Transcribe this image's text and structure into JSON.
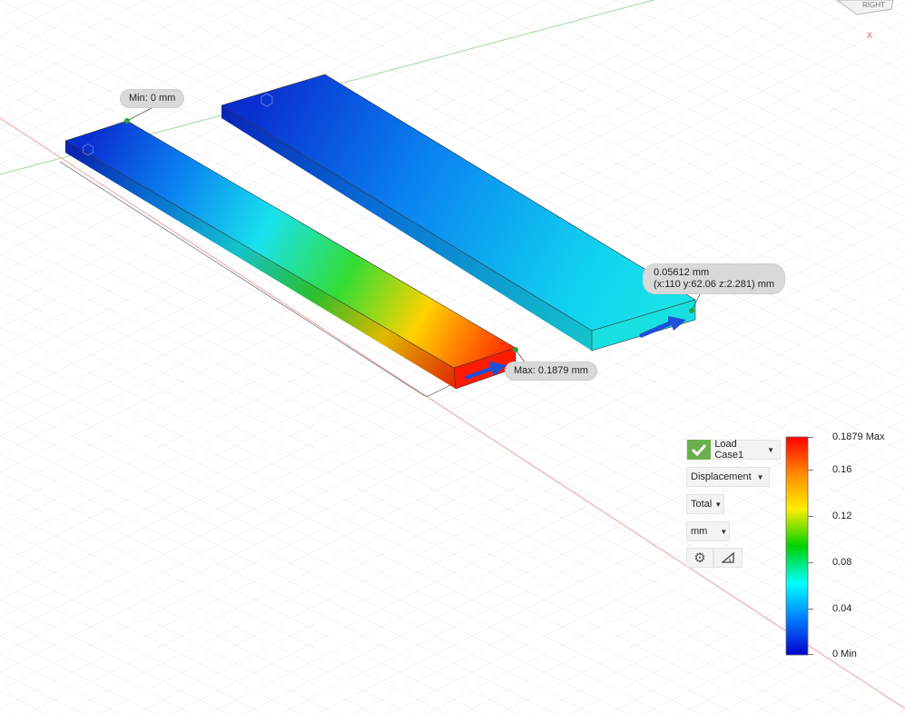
{
  "colors": {
    "accent_green": "#6ab04c",
    "callout_bg": "#d9d9d9",
    "colorbar_stops": [
      "#ff0000",
      "#ff8a00",
      "#ffee00",
      "#00d200",
      "#00ffff",
      "#0080ff",
      "#0000cc"
    ]
  },
  "viewcube": {
    "face_label": "RIGHT",
    "axis_label": "X"
  },
  "callouts": {
    "min": {
      "text": "Min: 0 mm"
    },
    "max": {
      "text": "Max: 0.1879 mm"
    },
    "probe": {
      "line1": "0.05612 mm",
      "line2": "(x:110 y:62.06 z:2.281) mm"
    }
  },
  "panel": {
    "load_case": "Load Case1",
    "result_type": "Displacement",
    "component": "Total",
    "unit": "mm",
    "settings_icon": "gear-icon",
    "deform_icon": "deformation-scale-icon"
  },
  "legend": {
    "max_label": "0.1879 Max",
    "ticks": [
      "0.16",
      "0.12",
      "0.08",
      "0.04"
    ],
    "min_label": "0 Min"
  }
}
